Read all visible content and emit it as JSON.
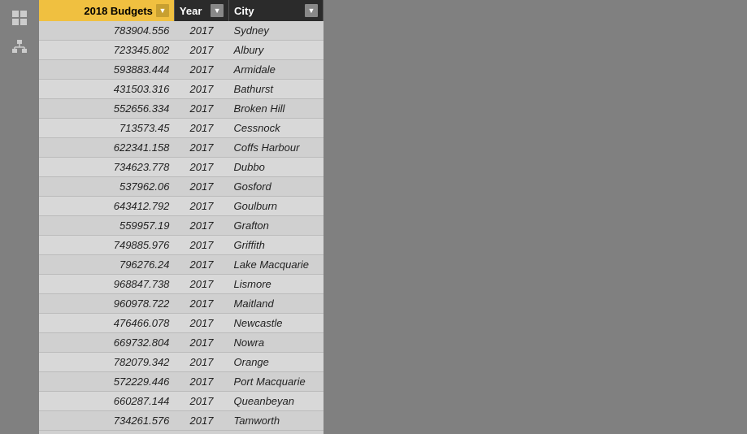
{
  "columns": [
    {
      "key": "budget",
      "label": "2018 Budgets",
      "type": "budget"
    },
    {
      "key": "year",
      "label": "Year",
      "type": "year"
    },
    {
      "key": "city",
      "label": "City",
      "type": "city"
    }
  ],
  "rows": [
    {
      "budget": "783904.556",
      "year": "2017",
      "city": "Sydney"
    },
    {
      "budget": "723345.802",
      "year": "2017",
      "city": "Albury"
    },
    {
      "budget": "593883.444",
      "year": "2017",
      "city": "Armidale"
    },
    {
      "budget": "431503.316",
      "year": "2017",
      "city": "Bathurst"
    },
    {
      "budget": "552656.334",
      "year": "2017",
      "city": "Broken Hill"
    },
    {
      "budget": "713573.45",
      "year": "2017",
      "city": "Cessnock"
    },
    {
      "budget": "622341.158",
      "year": "2017",
      "city": "Coffs Harbour"
    },
    {
      "budget": "734623.778",
      "year": "2017",
      "city": "Dubbo"
    },
    {
      "budget": "537962.06",
      "year": "2017",
      "city": "Gosford"
    },
    {
      "budget": "643412.792",
      "year": "2017",
      "city": "Goulburn"
    },
    {
      "budget": "559957.19",
      "year": "2017",
      "city": "Grafton"
    },
    {
      "budget": "749885.976",
      "year": "2017",
      "city": "Griffith"
    },
    {
      "budget": "796276.24",
      "year": "2017",
      "city": "Lake Macquarie"
    },
    {
      "budget": "968847.738",
      "year": "2017",
      "city": "Lismore"
    },
    {
      "budget": "960978.722",
      "year": "2017",
      "city": "Maitland"
    },
    {
      "budget": "476466.078",
      "year": "2017",
      "city": "Newcastle"
    },
    {
      "budget": "669732.804",
      "year": "2017",
      "city": "Nowra"
    },
    {
      "budget": "782079.342",
      "year": "2017",
      "city": "Orange"
    },
    {
      "budget": "572229.446",
      "year": "2017",
      "city": "Port Macquarie"
    },
    {
      "budget": "660287.144",
      "year": "2017",
      "city": "Queanbeyan"
    },
    {
      "budget": "734261.576",
      "year": "2017",
      "city": "Tamworth"
    }
  ],
  "icons": {
    "grid": "⊞",
    "hierarchy": "⊟"
  }
}
